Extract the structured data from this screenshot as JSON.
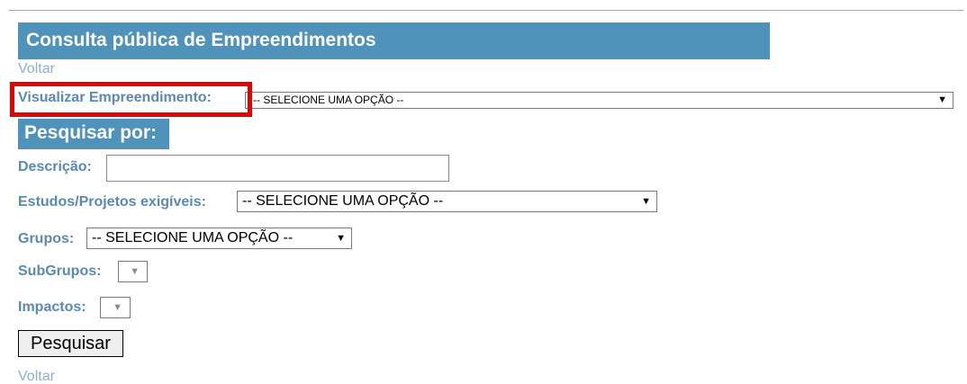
{
  "header": {
    "title": "Consulta pública de Empreendimentos"
  },
  "links": {
    "back_top": "Voltar",
    "back_bottom": "Voltar"
  },
  "view": {
    "label": "Visualizar Empreendimento:",
    "selected": "-- SELECIONE UMA OPÇÃO --"
  },
  "search": {
    "heading": "Pesquisar por:",
    "description_label": "Descrição:",
    "description_value": "",
    "studies_label": "Estudos/Projetos exigíveis:",
    "studies_selected": "-- SELECIONE UMA OPÇÃO --",
    "groups_label": "Grupos:",
    "groups_selected": "-- SELECIONE UMA OPÇÃO --",
    "subgroups_label": "SubGrupos:",
    "subgroups_selected": "",
    "impacts_label": "Impactos:",
    "impacts_selected": "",
    "submit_label": "Pesquisar"
  },
  "icons": {
    "dropdown": "chevron-down-icon"
  },
  "colors": {
    "banner": "#4f92ba",
    "label": "#5b8ab0",
    "link": "#8fb0c9",
    "highlight": "#e60000"
  }
}
